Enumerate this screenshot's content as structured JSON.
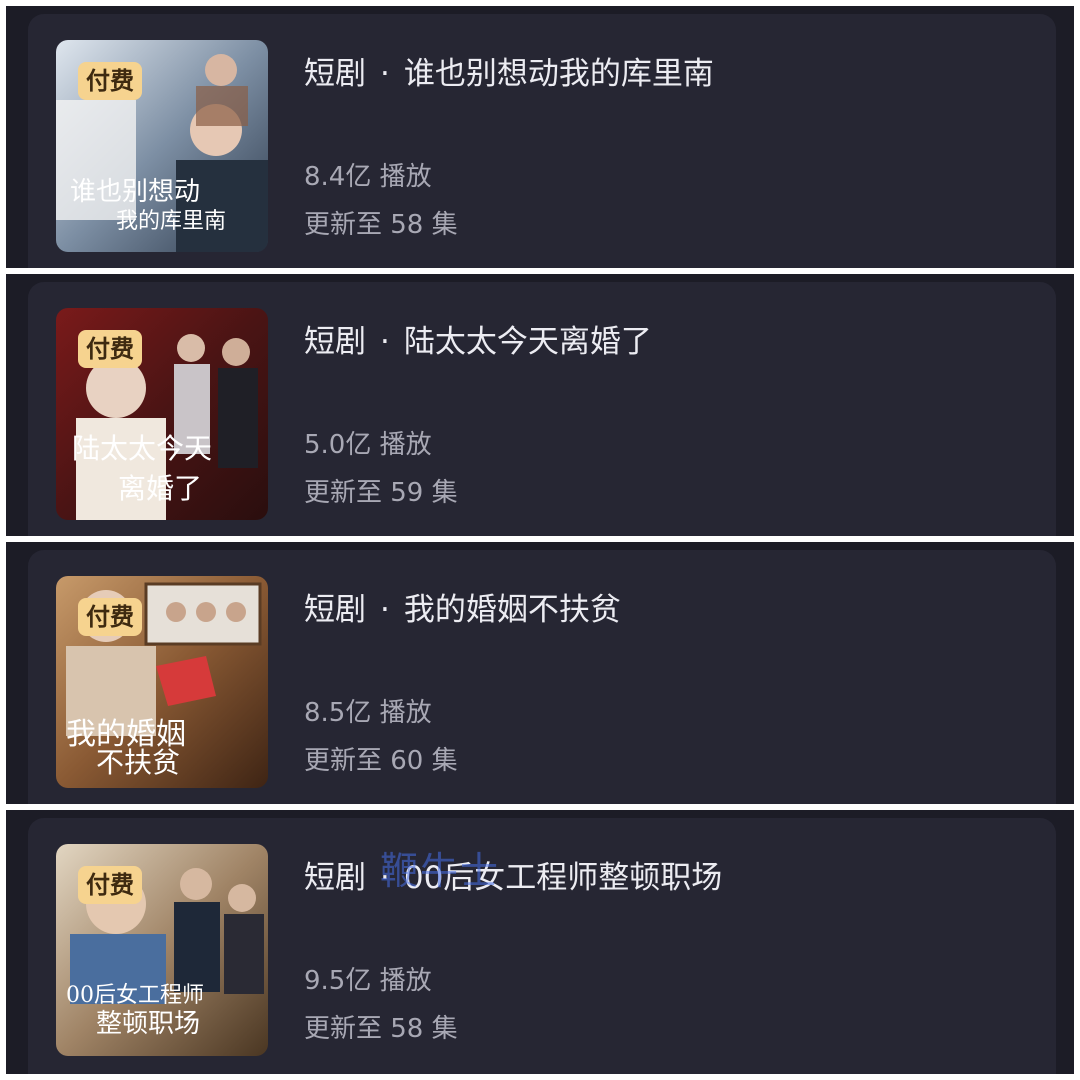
{
  "items": [
    {
      "badge": "付费",
      "category": "短剧",
      "dot": "·",
      "title": "谁也别想动我的库里南",
      "plays": "8.4亿 播放",
      "episodes": "更新至 58 集",
      "poster_text": [
        "谁也别想动",
        "我的库里南"
      ]
    },
    {
      "badge": "付费",
      "category": "短剧",
      "dot": "·",
      "title": "陆太太今天离婚了",
      "plays": "5.0亿 播放",
      "episodes": "更新至 59 集",
      "poster_text": [
        "陆太太今天",
        "离婚了"
      ]
    },
    {
      "badge": "付费",
      "category": "短剧",
      "dot": "·",
      "title": "我的婚姻不扶贫",
      "plays": "8.5亿 播放",
      "episodes": "更新至 60 集",
      "poster_text": [
        "我的婚姻",
        "不扶贫"
      ]
    },
    {
      "badge": "付费",
      "category": "短剧",
      "dot": "·",
      "title": "00后女工程师整顿职场",
      "plays": "9.5亿 播放",
      "episodes": "更新至 58 集",
      "poster_text": [
        "00后女工程师",
        "整顿职场"
      ]
    }
  ],
  "watermark": "鞭牛士"
}
